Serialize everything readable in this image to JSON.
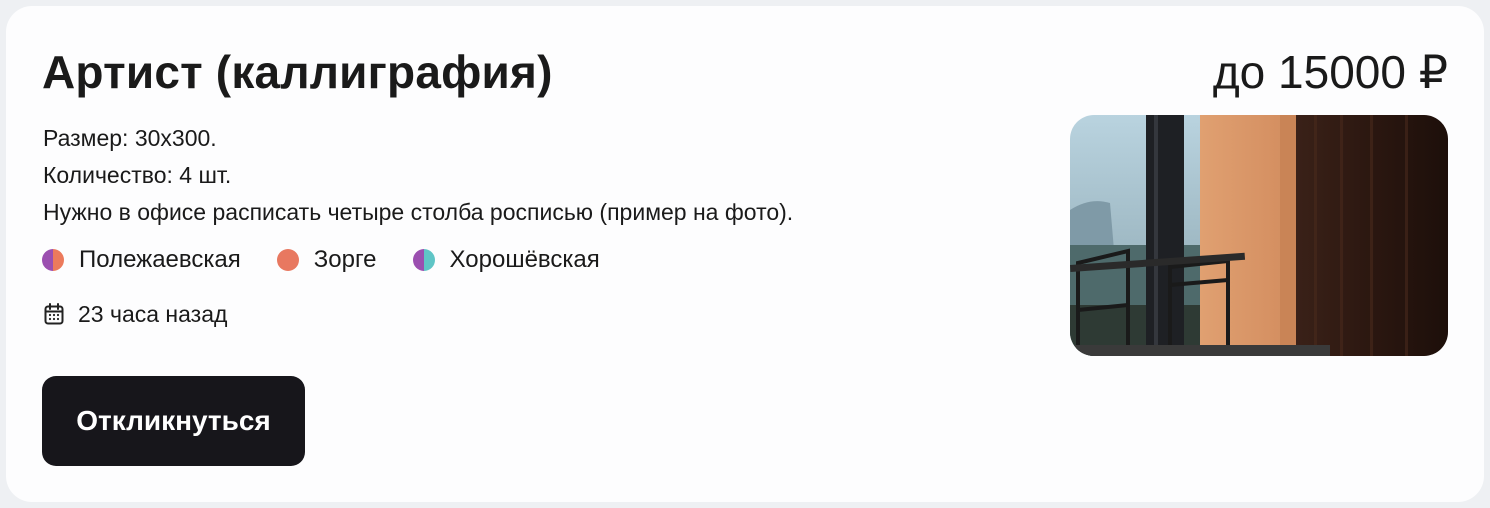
{
  "job": {
    "title": "Артист (каллиграфия)",
    "price": "до 15000 ₽",
    "description": [
      "Размер: 30х300.",
      "Количество: 4 шт.",
      "Нужно в офисе расписать четыре столба росписью (пример на фото)."
    ],
    "metro": [
      {
        "name": "Полежаевская",
        "colors": [
          "#9b4fb0",
          "#ec7a5c"
        ]
      },
      {
        "name": "Зорге",
        "colors": [
          "#e87860",
          "#e87860"
        ]
      },
      {
        "name": "Хорошёвская",
        "colors": [
          "#9b4fb0",
          "#5fc5c6"
        ]
      }
    ],
    "posted": "23 часа назад",
    "icons": {
      "time": "calendar-icon"
    }
  },
  "actions": {
    "respond_label": "Откликнуться"
  },
  "colors": {
    "button_bg": "#17161b",
    "card_bg": "#fdfdfe",
    "page_bg": "#eef0f3"
  }
}
